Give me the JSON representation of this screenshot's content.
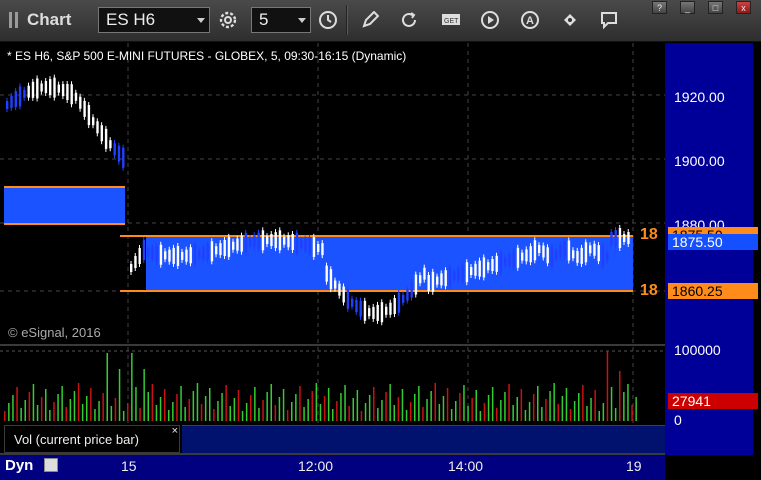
{
  "app": {
    "title": "Chart"
  },
  "toolbar": {
    "symbol": "ES H6",
    "interval": "5",
    "icons": [
      "settings-gear-icon",
      "clock-icon",
      "pencil-icon",
      "refresh-icon",
      "get-icon",
      "play-icon",
      "alert-icon",
      "tag-icon",
      "comment-icon"
    ]
  },
  "window_controls": [
    "?",
    "_",
    "□",
    "x"
  ],
  "chart_header": "* ES H6, S&P 500 E-MINI FUTURES - GLOBEX, 5, 09:30-16:15 (Dynamic)",
  "copyright": "© eSignal, 2016",
  "price_axis": {
    "labels": [
      "1920.00",
      "1900.00",
      "1880.00"
    ],
    "upper_tag": "1875.50",
    "lower_tag": "1860.25",
    "left_tag_upper": "18",
    "left_tag_lower": "18",
    "tag_color": "#ff8c1a",
    "last_price_bg": "#1450ff"
  },
  "volume_axis": {
    "top_label": "100000",
    "current": "27941",
    "zero": "0",
    "current_bg": "#cc0000"
  },
  "volume_legend": {
    "label": "Vol (current price bar)",
    "close": "×"
  },
  "time_axis": {
    "labels": [
      "15",
      "12:00",
      "14:00",
      "19"
    ]
  },
  "footer": {
    "mode": "Dyn"
  },
  "colors": {
    "up": "#ffffff",
    "down": "#2040ff",
    "zone": "#1a53ff",
    "level_line": "#ff8c1a",
    "vol_up": "#33cc33",
    "vol_down": "#cc1111",
    "axis_bg": "#000099"
  }
}
